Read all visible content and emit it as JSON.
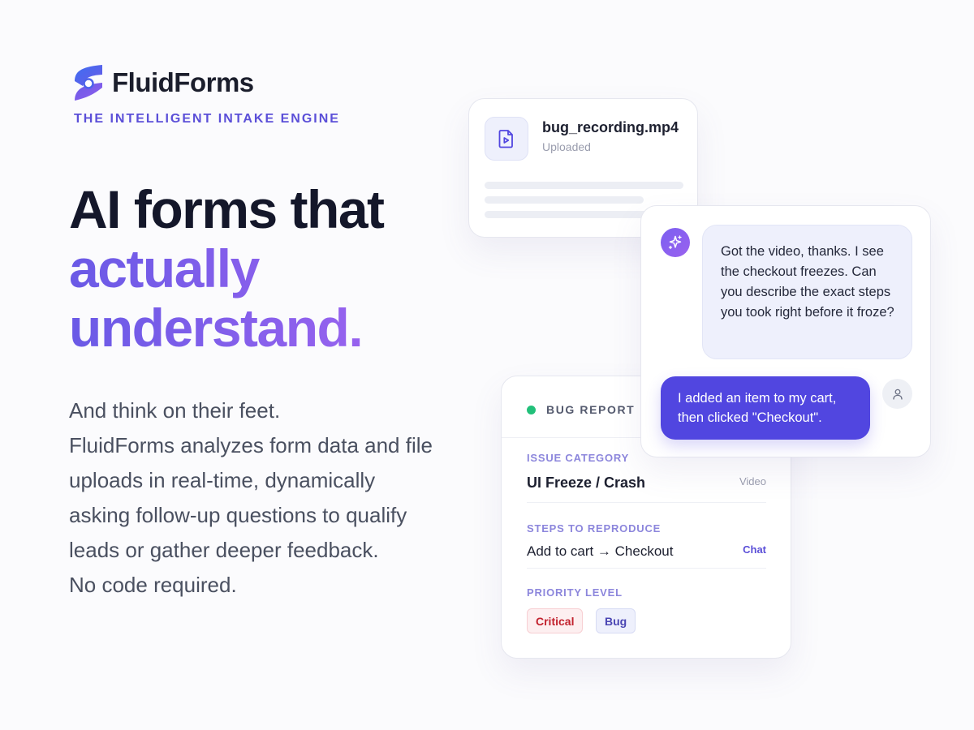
{
  "brand": {
    "name": "FluidForms",
    "tagline": "THE INTELLIGENT INTAKE ENGINE",
    "logo_icon": "fluidforms-logo-icon"
  },
  "hero": {
    "headline_line1": "AI forms that",
    "headline_line2": "actually",
    "headline_line3": "understand.",
    "description": [
      "And think on their feet.",
      "FluidForms analyzes form data and file",
      "uploads in real-time, dynamically",
      "asking follow-up questions to qualify",
      "leads or gather deeper feedback.",
      "No code required."
    ]
  },
  "upload_card": {
    "icon": "video-file-icon",
    "file_name": "bug_recording.mp4",
    "status": "Uploaded"
  },
  "chat": {
    "ai_icon": "sparkle-icon",
    "user_icon": "user-icon",
    "ai_message": "Got the video, thanks. I see the checkout freezes. Can you describe the exact steps you took right before it froze?",
    "user_message": "I added an item to my cart, then clicked \"Checkout\"."
  },
  "report": {
    "title": "BUG REPORT",
    "status_color": "#22c07a",
    "issue_category": {
      "label": "ISSUE CATEGORY",
      "value": "UI Freeze / Crash",
      "source": "Video"
    },
    "steps": {
      "label": "STEPS TO REPRODUCE",
      "value": "Add to cart → Checkout",
      "source": "Chat"
    },
    "priority": {
      "label": "PRIORITY LEVEL",
      "badges": [
        "Critical",
        "Bug"
      ]
    }
  },
  "colors": {
    "accent": "#5146e0",
    "accent_gradient_start": "#6a5ae6",
    "accent_gradient_end": "#9a63ef",
    "critical": "#c2222e"
  }
}
